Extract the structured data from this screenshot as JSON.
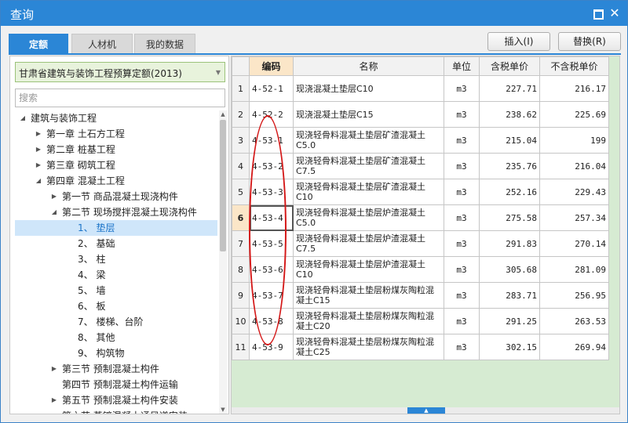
{
  "window": {
    "title": "查询"
  },
  "tabs": [
    {
      "label": "定额",
      "active": true
    },
    {
      "label": "人材机",
      "active": false
    },
    {
      "label": "我的数据",
      "active": false
    }
  ],
  "toolbar": {
    "insert_label": "插入(I)",
    "replace_label": "替换(R)"
  },
  "left": {
    "quota_library": "甘肃省建筑与装饰工程预算定额(2013)",
    "search_placeholder": "搜索",
    "tree": [
      {
        "label": "建筑与装饰工程",
        "level": 0,
        "toggle": "◢"
      },
      {
        "label": "第一章 土石方工程",
        "level": 1,
        "toggle": "▶"
      },
      {
        "label": "第二章 桩基工程",
        "level": 1,
        "toggle": "▶"
      },
      {
        "label": "第三章 砌筑工程",
        "level": 1,
        "toggle": "▶"
      },
      {
        "label": "第四章 混凝土工程",
        "level": 1,
        "toggle": "◢"
      },
      {
        "label": "第一节 商品混凝土现浇构件",
        "level": 2,
        "toggle": "▶"
      },
      {
        "label": "第二节 现场搅拌混凝土现浇构件",
        "level": 2,
        "toggle": "◢"
      },
      {
        "label": "1、 垫层",
        "level": 3,
        "toggle": "",
        "selected": true
      },
      {
        "label": "2、 基础",
        "level": 3,
        "toggle": ""
      },
      {
        "label": "3、 柱",
        "level": 3,
        "toggle": ""
      },
      {
        "label": "4、 梁",
        "level": 3,
        "toggle": ""
      },
      {
        "label": "5、 墙",
        "level": 3,
        "toggle": ""
      },
      {
        "label": "6、 板",
        "level": 3,
        "toggle": ""
      },
      {
        "label": "7、 楼梯、台阶",
        "level": 3,
        "toggle": ""
      },
      {
        "label": "8、 其他",
        "level": 3,
        "toggle": ""
      },
      {
        "label": "9、 构筑物",
        "level": 3,
        "toggle": ""
      },
      {
        "label": "第三节 预制混凝土构件",
        "level": 2,
        "toggle": "▶"
      },
      {
        "label": "第四节 预制混凝土构件运输",
        "level": 2,
        "toggle": ""
      },
      {
        "label": "第五节 预制混凝土构件安装",
        "level": 2,
        "toggle": "▶"
      },
      {
        "label": "第六节 蒸镀混凝土通风道安装",
        "level": 2,
        "toggle": ""
      }
    ]
  },
  "grid": {
    "headers": [
      "",
      "编码",
      "名称",
      "单位",
      "含税单价",
      "不含税单价"
    ],
    "sorted_column": 1,
    "current_row": 6,
    "rows": [
      {
        "no": "1",
        "code": "4-52-1",
        "name": "现浇混凝土垫层C10",
        "unit": "m3",
        "price_tax": "227.71",
        "price_notax": "216.17"
      },
      {
        "no": "2",
        "code": "4-52-2",
        "name": "现浇混凝土垫层C15",
        "unit": "m3",
        "price_tax": "238.62",
        "price_notax": "225.69"
      },
      {
        "no": "3",
        "code": "4-53-1",
        "name": "现浇轻骨料混凝土垫层矿渣混凝土C5.0",
        "unit": "m3",
        "price_tax": "215.04",
        "price_notax": "199"
      },
      {
        "no": "4",
        "code": "4-53-2",
        "name": "现浇轻骨料混凝土垫层矿渣混凝土C7.5",
        "unit": "m3",
        "price_tax": "235.76",
        "price_notax": "216.04"
      },
      {
        "no": "5",
        "code": "4-53-3",
        "name": "现浇轻骨料混凝土垫层矿渣混凝土C10",
        "unit": "m3",
        "price_tax": "252.16",
        "price_notax": "229.43"
      },
      {
        "no": "6",
        "code": "4-53-4",
        "name": "现浇轻骨料混凝土垫层炉渣混凝土C5.0",
        "unit": "m3",
        "price_tax": "275.58",
        "price_notax": "257.34"
      },
      {
        "no": "7",
        "code": "4-53-5",
        "name": "现浇轻骨料混凝土垫层炉渣混凝土C7.5",
        "unit": "m3",
        "price_tax": "291.83",
        "price_notax": "270.14"
      },
      {
        "no": "8",
        "code": "4-53-6",
        "name": "现浇轻骨料混凝土垫层炉渣混凝土C10",
        "unit": "m3",
        "price_tax": "305.68",
        "price_notax": "281.09"
      },
      {
        "no": "9",
        "code": "4-53-7",
        "name": "现浇轻骨料混凝土垫层粉煤灰陶粒混凝土C15",
        "unit": "m3",
        "price_tax": "283.71",
        "price_notax": "256.95"
      },
      {
        "no": "10",
        "code": "4-53-8",
        "name": "现浇轻骨料混凝土垫层粉煤灰陶粒混凝土C20",
        "unit": "m3",
        "price_tax": "291.25",
        "price_notax": "263.53"
      },
      {
        "no": "11",
        "code": "4-53-9",
        "name": "现浇轻骨料混凝土垫层粉煤灰陶粒混凝土C25",
        "unit": "m3",
        "price_tax": "302.15",
        "price_notax": "269.94"
      }
    ]
  },
  "colors": {
    "accent": "#2b86d6",
    "annotation": "#d41818",
    "panel_green": "#d6ebd2",
    "selected_header": "#fbe6c8"
  }
}
